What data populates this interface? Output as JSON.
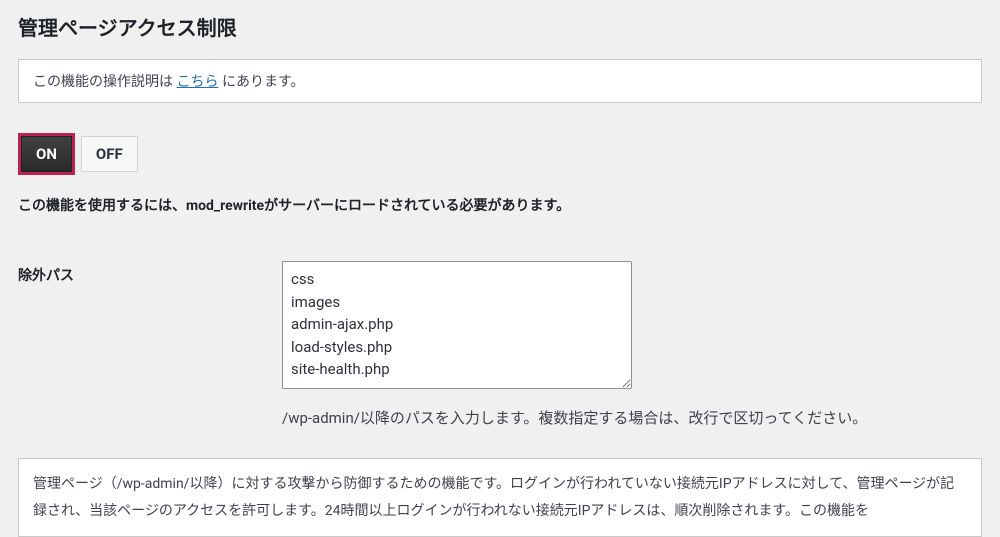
{
  "heading": "管理ページアクセス制限",
  "notice": {
    "before": "この機能の操作説明は ",
    "link": "こちら",
    "after": " にあります。"
  },
  "toggle": {
    "on": "ON",
    "off": "OFF"
  },
  "requirement_note": "この機能を使用するには、mod_rewriteがサーバーにロードされている必要があります。",
  "field": {
    "label": "除外パス",
    "value": "css\nimages\nadmin-ajax.php\nload-styles.php\nsite-health.php",
    "desc": "/wp-admin/以降のパスを入力します。複数指定する場合は、改行で区切ってください。"
  },
  "info_box": "管理ページ（/wp-admin/以降）に対する攻撃から防御するための機能です。ログインが行われていない接続元IPアドレスに対して、管理ページが記録され、当該ページのアクセスを許可します。24時間以上ログインが行われない接続元IPアドレスは、順次削除されます。この機能を"
}
